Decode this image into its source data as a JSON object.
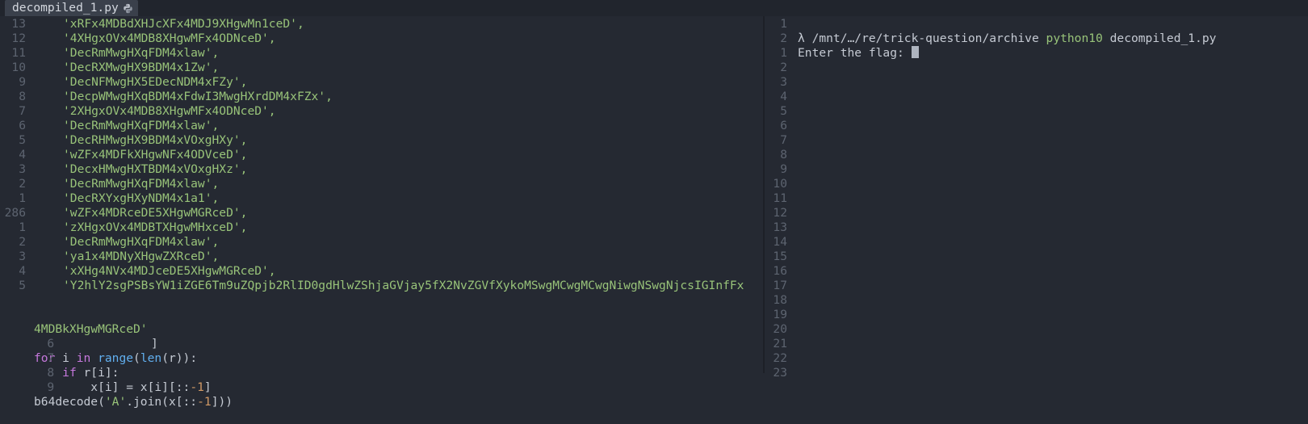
{
  "tab": {
    "label": "decompiled_1.py",
    "icon": "python-icon"
  },
  "editor": {
    "string_lines": [
      {
        "num": "13",
        "text": "'xRFx4MDBdXHJcXFx4MDJ9XHgwMn1ceD',"
      },
      {
        "num": "12",
        "text": "'4XHgxOVx4MDB8XHgwMFx4ODNceD',"
      },
      {
        "num": "11",
        "text": "'DecRmMwgHXqFDM4xlaw',"
      },
      {
        "num": "10",
        "text": "'DecRXMwgHX9BDM4x1Zw',"
      },
      {
        "num": "9",
        "text": "'DecNFMwgHX5EDecNDM4xFZy',"
      },
      {
        "num": "8",
        "text": "'DecpWMwgHXqBDM4xFdwI3MwgHXrdDM4xFZx',"
      },
      {
        "num": "7",
        "text": "'2XHgxOVx4MDB8XHgwMFx4ODNceD',"
      },
      {
        "num": "6",
        "text": "'DecRmMwgHXqFDM4xlaw',"
      },
      {
        "num": "5",
        "text": "'DecRHMwgHX9BDM4xVOxgHXy',"
      },
      {
        "num": "4",
        "text": "'wZFx4MDFkXHgwNFx4ODVceD',"
      },
      {
        "num": "3",
        "text": "'DecxHMwgHXTBDM4xVOxgHXz',"
      },
      {
        "num": "2",
        "text": "'DecRmMwgHXqFDM4xlaw',"
      },
      {
        "num": "1",
        "text": "'DecRXYxgHXyNDM4x1a1',"
      },
      {
        "num": "286",
        "text": "'wZFx4MDRceDE5XHgwMGRceD',"
      },
      {
        "num": "1",
        "text": "'zXHgxOVx4MDBTXHgwMHxceD',"
      },
      {
        "num": "2",
        "text": "'DecRmMwgHXqFDM4xlaw',"
      },
      {
        "num": "3",
        "text": "'ya1x4MDNyXHgwZXRceD',"
      },
      {
        "num": "4",
        "text": "'xXHg4NVx4MDJceDE5XHgwMGRceD',"
      },
      {
        "num": "5",
        "text": "'Y2hlY2sgPSBsYW1iZGE6Tm9uZQpjb2RlID0gdHlwZShjaGVjay5fX2NvZGVfXykoMSwgMCwgMCwgNiwgNSwgNjcsIGInfFx"
      }
    ],
    "wrap_line": {
      "text": "4MDBkXHgwMGRceD'",
      "close": "]"
    },
    "code": {
      "l6": {
        "num": "6",
        "kw_for": "for",
        "var_i": " i ",
        "kw_in": "in",
        "fn_range": "range",
        "p1": "(",
        "fn_len": "len",
        "p2": "(r)):"
      },
      "l7": {
        "num": "7",
        "kw_if": "if",
        "rest": " r[i]:"
      },
      "l8": {
        "num": "8",
        "a": "x[i] = x[i][::",
        "neg": "-1",
        "b": "]"
      },
      "l9": {
        "num": "9",
        "a": "b64decode(",
        "str": "'A'",
        "b": ".join(x[::",
        "neg": "-1",
        "c": "]))"
      }
    }
  },
  "terminal": {
    "prompt": "λ /mnt/…/re/trick-question/archive",
    "command": "python10",
    "arg": "decompiled_1.py",
    "input_prompt": "Enter the flag: ",
    "line_numbers": [
      "1",
      "2",
      "1",
      "2",
      "3",
      "4",
      "5",
      "6",
      "7",
      "8",
      "9",
      "10",
      "11",
      "12",
      "13",
      "14",
      "15",
      "16",
      "17",
      "18",
      "19",
      "20",
      "21",
      "22",
      "23"
    ]
  },
  "colors": {
    "background": "#252932",
    "string": "#98c379",
    "keyword": "#c678dd",
    "function": "#61afef",
    "number": "#d19a66"
  }
}
